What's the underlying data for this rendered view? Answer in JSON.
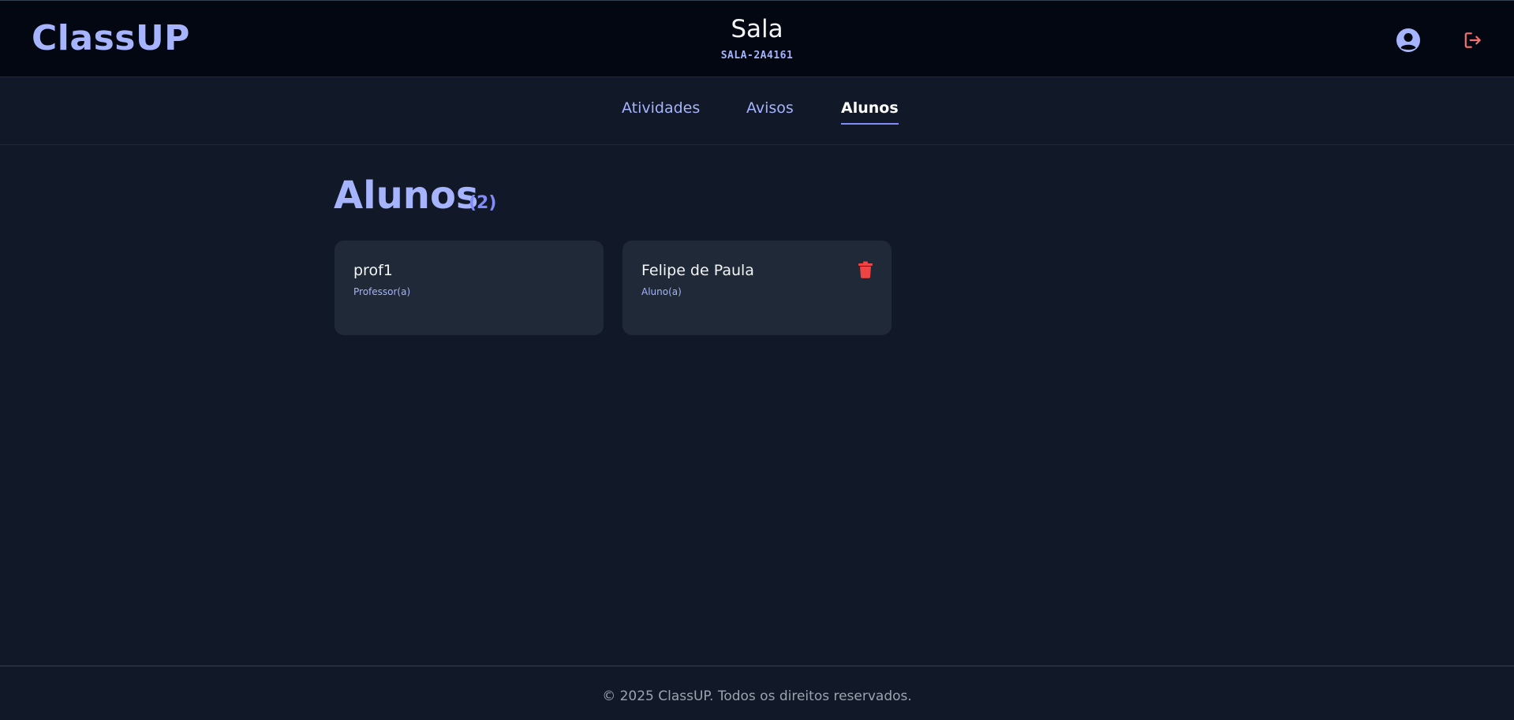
{
  "header": {
    "logo": "ClassUP",
    "room_title": "Sala",
    "room_code": "SALA-2A4161",
    "icons": {
      "user": "user-circle-icon",
      "logout": "logout-icon"
    }
  },
  "tabs": [
    {
      "label": "Atividades",
      "active": false
    },
    {
      "label": "Avisos",
      "active": false
    },
    {
      "label": "Alunos",
      "active": true
    }
  ],
  "main": {
    "heading": "Alunos",
    "count": "(2)",
    "members": [
      {
        "name": "prof1",
        "role": "Professor(a)",
        "deletable": false
      },
      {
        "name": "Felipe de Paula",
        "role": "Aluno(a)",
        "deletable": true,
        "action_icon": "trash-icon"
      }
    ]
  },
  "footer": {
    "text": "© 2025 ClassUP. Todos os direitos reservados."
  },
  "colors": {
    "background": "#111827",
    "header_bg": "#030712",
    "card_bg": "#1f2937",
    "accent": "#a5b4fc",
    "danger": "#ef4444",
    "logout": "#f87171"
  }
}
